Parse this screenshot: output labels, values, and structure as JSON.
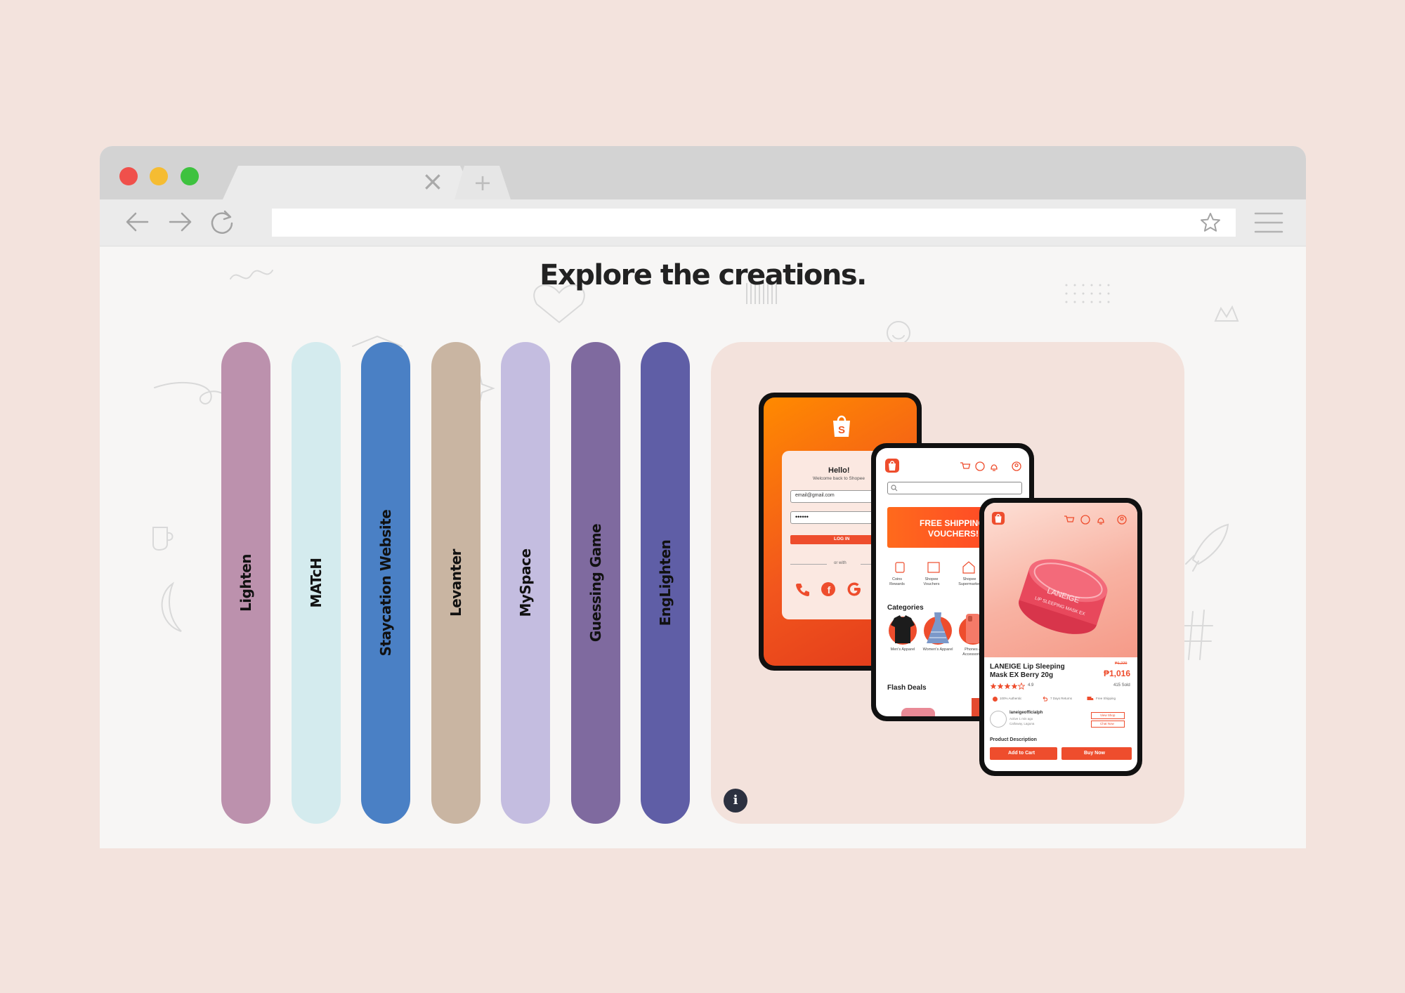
{
  "page": {
    "heading": "Explore the creations."
  },
  "browser": {
    "tab_close": "×",
    "new_tab": "+"
  },
  "projects": [
    {
      "label": "Lighten",
      "color": "#bc91ad"
    },
    {
      "label": "MATcH",
      "color": "#d4ebee"
    },
    {
      "label": "Staycation Website",
      "color": "#4a80c5"
    },
    {
      "label": "Levanter",
      "color": "#c9b5a2"
    },
    {
      "label": "MySpace",
      "color": "#c4bde0"
    },
    {
      "label": "Guessing Game",
      "color": "#7f6a9f"
    },
    {
      "label": "EngLighten",
      "color": "#5f5ea6"
    }
  ],
  "preview": {
    "info_icon": "i",
    "login": {
      "greeting": "Hello!",
      "subtitle": "Welcome back to Shopee",
      "email": "email@gmail.com",
      "password": "••••••",
      "button": "LOG IN",
      "divider": "or with"
    },
    "home": {
      "banner_line1": "FREE SHIPPING",
      "banner_line2": "VOUCHERS!",
      "shortcuts": [
        "Coins Rewards",
        "Shopee Vouchers",
        "Shopee Supermarket"
      ],
      "categories_title": "Categories",
      "categories": [
        "Men's Apparel",
        "Women's Apparel",
        "Phones & Accessories"
      ],
      "flash_deals": "Flash Deals"
    },
    "product": {
      "jar_brand": "LANEIGE",
      "jar_text": "LIP SLEEPING MASK EX",
      "title_line1": "LANEIGE Lip Sleeping",
      "title_line2": "Mask EX Berry 20g",
      "old_price": "₱1,229",
      "price": "₱1,016",
      "rating": "4.9",
      "sold": "415 Sold",
      "badges": [
        "100% Authentic",
        "7 Days Returns",
        "Free Shipping"
      ],
      "shop_name": "laneigeofficialph",
      "shop_status": "Active 1 min ago",
      "shop_location": "Calloway, Laguna",
      "view_shop": "View Shop",
      "chat_now": "Chat Now",
      "description_label": "Product Description",
      "add_to_cart": "Add to Cart",
      "buy_now": "Buy Now"
    }
  }
}
